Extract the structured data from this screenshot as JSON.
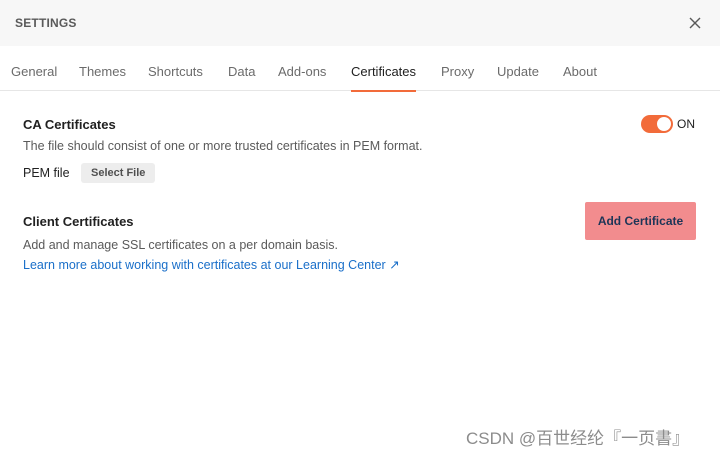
{
  "window": {
    "title": "SETTINGS",
    "close_icon": "close-icon"
  },
  "tabs": [
    {
      "label": "General"
    },
    {
      "label": "Themes"
    },
    {
      "label": "Shortcuts"
    },
    {
      "label": "Data"
    },
    {
      "label": "Add-ons"
    },
    {
      "label": "Certificates",
      "active": true
    },
    {
      "label": "Proxy"
    },
    {
      "label": "Update"
    },
    {
      "label": "About"
    }
  ],
  "ca": {
    "title": "CA Certificates",
    "description": "The file should consist of one or more trusted certificates in PEM format.",
    "pem_label": "PEM file",
    "select_file_label": "Select File",
    "toggle_state": "ON"
  },
  "client": {
    "title": "Client Certificates",
    "description": "Add and manage SSL certificates on a per domain basis.",
    "link_text": "Learn more about working with certificates at our Learning Center ↗",
    "add_button_label": "Add Certificate"
  },
  "watermark": "CSDN @百世经纶『一页書』",
  "colors": {
    "accent": "#f26b3a",
    "link": "#1a6fc9",
    "add_button_bg": "#f28c8e"
  }
}
